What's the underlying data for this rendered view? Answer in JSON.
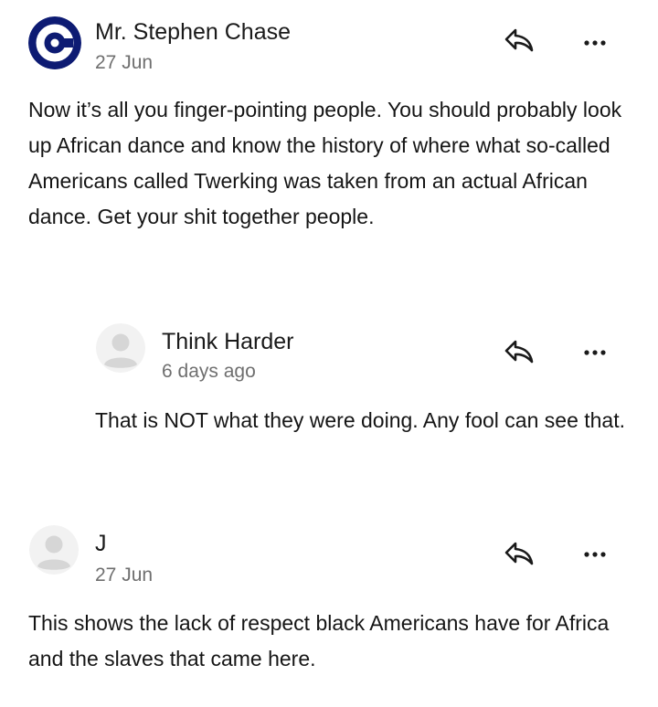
{
  "colors": {
    "brand_avatar_bg": "#0d1b73",
    "placeholder_avatar_bg": "#f2f2f2",
    "placeholder_avatar_fg": "#d6d6d6",
    "text_primary": "#151515",
    "text_secondary": "#6f6f6f"
  },
  "comments": [
    {
      "author": "Mr. Stephen Chase",
      "date": "27 Jun",
      "avatar_icon": "brand-logo-c-icon",
      "text": "Now it’s all you finger-pointing people. You should probably look up African dance and know the history of where what so-called Americans called Twerking was taken from an actual African dance. Get your shit together people."
    },
    {
      "author": "Think Harder",
      "date": "6 days ago",
      "avatar_icon": "default-user-icon",
      "text": "That is NOT what they were doing.  Any fool can see that."
    },
    {
      "author": "J",
      "date": "27 Jun",
      "avatar_icon": "default-user-icon",
      "text": "This shows the lack of respect black Americans have for Africa and the slaves that came here."
    }
  ],
  "icons": {
    "reply": "reply-arrow-icon",
    "more": "more-options-icon"
  }
}
